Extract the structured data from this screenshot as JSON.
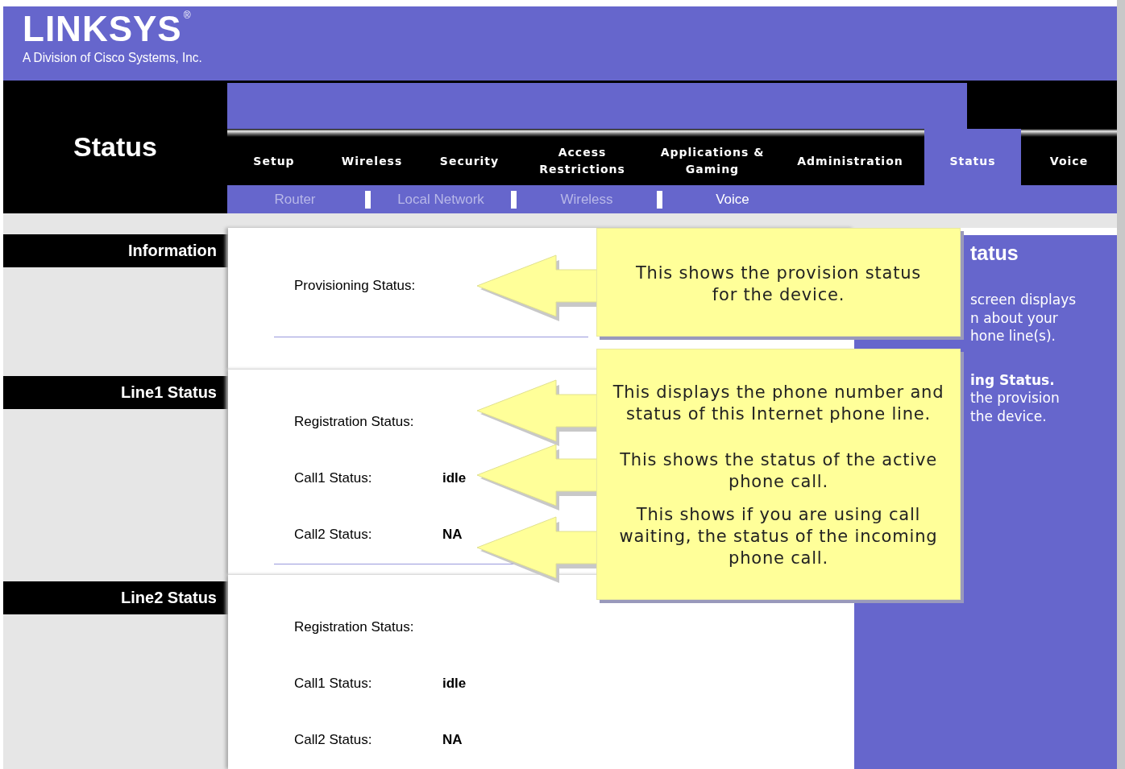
{
  "header": {
    "logo": "LINKSYS",
    "logo_mark": "®",
    "tagline": "A Division of Cisco Systems, Inc."
  },
  "page_title": "Status",
  "tabs": [
    {
      "label": "Setup",
      "selected": false
    },
    {
      "label": "Wireless",
      "selected": false
    },
    {
      "label": "Security",
      "selected": false
    },
    {
      "label": "Access Restrictions",
      "selected": false
    },
    {
      "label": "Applications & Gaming",
      "selected": false
    },
    {
      "label": "Administration",
      "selected": false
    },
    {
      "label": "Status",
      "selected": true
    },
    {
      "label": "Voice",
      "selected": false
    }
  ],
  "subtabs": [
    {
      "label": "Router",
      "selected": false
    },
    {
      "label": "Local Network",
      "selected": false
    },
    {
      "label": "Wireless",
      "selected": false
    },
    {
      "label": "Voice",
      "selected": true
    }
  ],
  "sections": [
    {
      "title": "Information",
      "rows": [
        {
          "label": "Provisioning Status:"
        }
      ]
    },
    {
      "title": "Line1 Status",
      "rows": [
        {
          "label": "Registration Status:"
        },
        {
          "label": "Call1 Status:",
          "value": "idle"
        },
        {
          "label": "Call2 Status:",
          "value": "NA"
        }
      ]
    },
    {
      "title": "Line2 Status",
      "rows": [
        {
          "label": "Registration Status:"
        },
        {
          "label": "Call1 Status:",
          "value": "idle"
        },
        {
          "label": "Call2 Status:",
          "value": "NA"
        }
      ]
    }
  ],
  "help_panel": {
    "title": "tatus",
    "paragraphs": [
      {
        "lines": [
          "screen displays",
          "n about your",
          "hone line(s)."
        ]
      },
      {
        "heading": "ing Status.",
        "lines": [
          "the provision",
          "the device."
        ]
      }
    ]
  },
  "callouts": [
    {
      "paragraphs": [
        "This shows the provision status for the device."
      ]
    },
    {
      "paragraphs": [
        "This displays the phone number and status of this Internet phone line.",
        "This shows the status of the active phone call.",
        "This shows if you are using call waiting, the status of the incoming phone call."
      ]
    }
  ]
}
